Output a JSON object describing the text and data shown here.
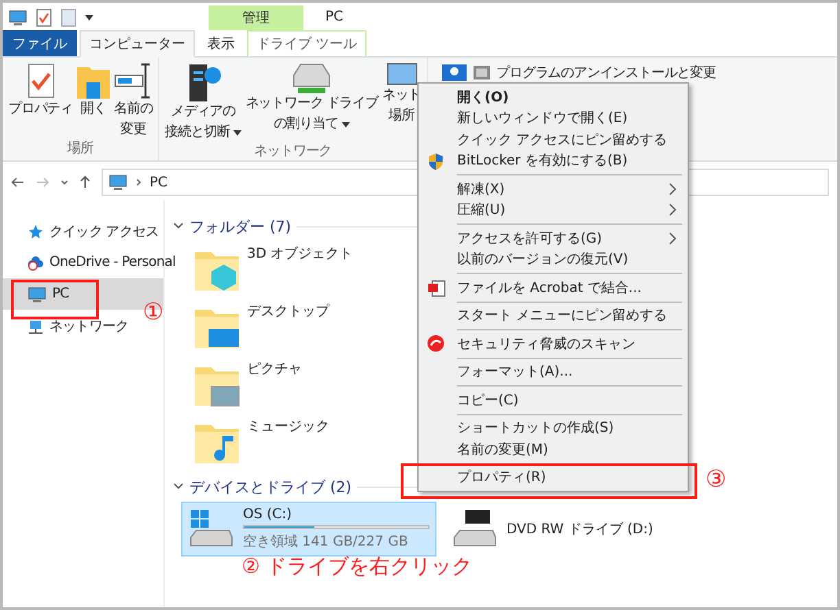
{
  "window": {
    "title": "PC"
  },
  "context_tab_group": {
    "title": "管理"
  },
  "tabs": [
    {
      "label": "ファイル",
      "kind": "file",
      "selected": false
    },
    {
      "label": "コンピューター",
      "kind": "tab",
      "selected": true
    },
    {
      "label": "表示",
      "kind": "tab",
      "selected": false
    },
    {
      "label": "ドライブ ツール",
      "kind": "context",
      "selected": false
    }
  ],
  "ribbon_groups": [
    {
      "label": "場所",
      "buttons": [
        {
          "lines": [
            "プロパティ"
          ],
          "dropdown": false
        },
        {
          "lines": [
            "開く"
          ],
          "dropdown": false
        },
        {
          "lines": [
            "名前の",
            "変更"
          ],
          "dropdown": false
        }
      ]
    },
    {
      "label": "ネットワーク",
      "buttons": [
        {
          "lines": [
            "メディアの",
            "接続と切断"
          ],
          "dropdown": true
        },
        {
          "lines": [
            "ネットワーク ドライブ",
            "の割り当て"
          ],
          "dropdown": true
        },
        {
          "lines": [
            "ネット",
            "場所"
          ],
          "dropdown": false
        }
      ]
    },
    {
      "buttons": [
        {
          "lines": [
            "プログラムのアンインストールと変更"
          ]
        }
      ]
    }
  ],
  "address_bar": {
    "path": "PC"
  },
  "navigation_pane": {
    "items": [
      {
        "label": "クイック アクセス",
        "selected": false
      },
      {
        "label": "OneDrive - Personal",
        "selected": false
      },
      {
        "label": "PC",
        "selected": true
      },
      {
        "label": "ネットワーク",
        "selected": false
      }
    ]
  },
  "folders": {
    "title": "フォルダー (7)",
    "expanded": true,
    "items": [
      {
        "label": "3D オブジェクト"
      },
      {
        "label": "デスクトップ"
      },
      {
        "label": "ピクチャ"
      },
      {
        "label": "ミュージック"
      }
    ]
  },
  "drives": {
    "title": "デバイスとドライブ (2)",
    "expanded": true,
    "items": [
      {
        "name": "OS (C:)",
        "level": 0.38,
        "free": "空き領域 141 GB/227 GB",
        "selected": true
      },
      {
        "name": "DVD RW ドライブ (D:)",
        "selected": false
      }
    ]
  },
  "context_menu": {
    "items": [
      {
        "kind": "item",
        "label": "開く(O)",
        "default": true,
        "submenu": false
      },
      {
        "kind": "item",
        "label": "新しいウィンドウで開く(E)",
        "default": false,
        "submenu": false
      },
      {
        "kind": "item",
        "label": "クイック アクセスにピン留めする",
        "default": false,
        "submenu": false
      },
      {
        "kind": "item",
        "label": "BitLocker を有効にする(B)",
        "default": false,
        "submenu": false
      },
      {
        "kind": "separator"
      },
      {
        "kind": "item",
        "label": "解凍(X)",
        "default": false,
        "submenu": true
      },
      {
        "kind": "item",
        "label": "圧縮(U)",
        "default": false,
        "submenu": true
      },
      {
        "kind": "separator"
      },
      {
        "kind": "item",
        "label": "アクセスを許可する(G)",
        "default": false,
        "submenu": true
      },
      {
        "kind": "item",
        "label": "以前のバージョンの復元(V)",
        "default": false,
        "submenu": false
      },
      {
        "kind": "separator"
      },
      {
        "kind": "item",
        "label": "ファイルを Acrobat で結合...",
        "default": false,
        "submenu": false
      },
      {
        "kind": "separator"
      },
      {
        "kind": "item",
        "label": "スタート メニューにピン留めする",
        "default": false,
        "submenu": false
      },
      {
        "kind": "separator"
      },
      {
        "kind": "item",
        "label": "セキュリティ脅威のスキャン",
        "default": false,
        "submenu": false
      },
      {
        "kind": "separator"
      },
      {
        "kind": "item",
        "label": "フォーマット(A)...",
        "default": false,
        "submenu": false
      },
      {
        "kind": "separator"
      },
      {
        "kind": "item",
        "label": "コピー(C)",
        "default": false,
        "submenu": false
      },
      {
        "kind": "separator"
      },
      {
        "kind": "item",
        "label": "ショートカットの作成(S)",
        "default": false,
        "submenu": false
      },
      {
        "kind": "item",
        "label": "名前の変更(M)",
        "default": false,
        "submenu": false
      },
      {
        "kind": "separator"
      },
      {
        "kind": "item",
        "label": "プロパティ(R)",
        "default": false,
        "submenu": false
      }
    ]
  },
  "annotations": [
    {
      "label": "①"
    },
    {
      "label": "② ドライブを右クリック"
    },
    {
      "label": "③"
    }
  ]
}
